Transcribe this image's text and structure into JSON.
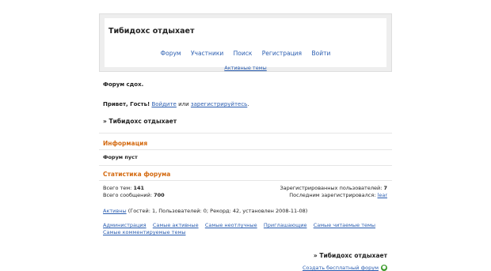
{
  "header": {
    "title": "Тибидохс отдыхает",
    "nav": [
      "Форум",
      "Участники",
      "Поиск",
      "Регистрация",
      "Войти"
    ],
    "active_topics": "Активные темы"
  },
  "intro": {
    "forum_desc": "Форум сдох.",
    "greeting": "Привет, Гость!",
    "login_link": "Войдите",
    "or_text": "или",
    "register_link": "зарегистрируйтесь",
    "period": "."
  },
  "breadcrumb_top": "» Тибидохс отдыхает",
  "info": {
    "title": "Информация",
    "text": "Форум пуст"
  },
  "stats": {
    "title": "Статистика форума",
    "topics_label": "Всего тем:",
    "topics_value": "141",
    "posts_label": "Всего сообщений:",
    "posts_value": "700",
    "registered_label": "Зарегистрированных пользователей:",
    "registered_value": "7",
    "last_registered_label": "Последним зарегистрировался:",
    "last_registered_value": "lear",
    "active_link": "Активны",
    "active_text": "(Гостей: 1, Пользователей: 0; Рекорд: 42, установлен 2008-11-08)"
  },
  "bottom_links": [
    "Администрация",
    "Самые активные",
    "Самые неотлучные",
    "Приглашающие",
    "Самые читаемые темы",
    "Самые комментируемые темы"
  ],
  "breadcrumb_bottom": "» Тибидохс отдыхает",
  "footer": {
    "create_forum": "Создать бесплатный форум"
  }
}
